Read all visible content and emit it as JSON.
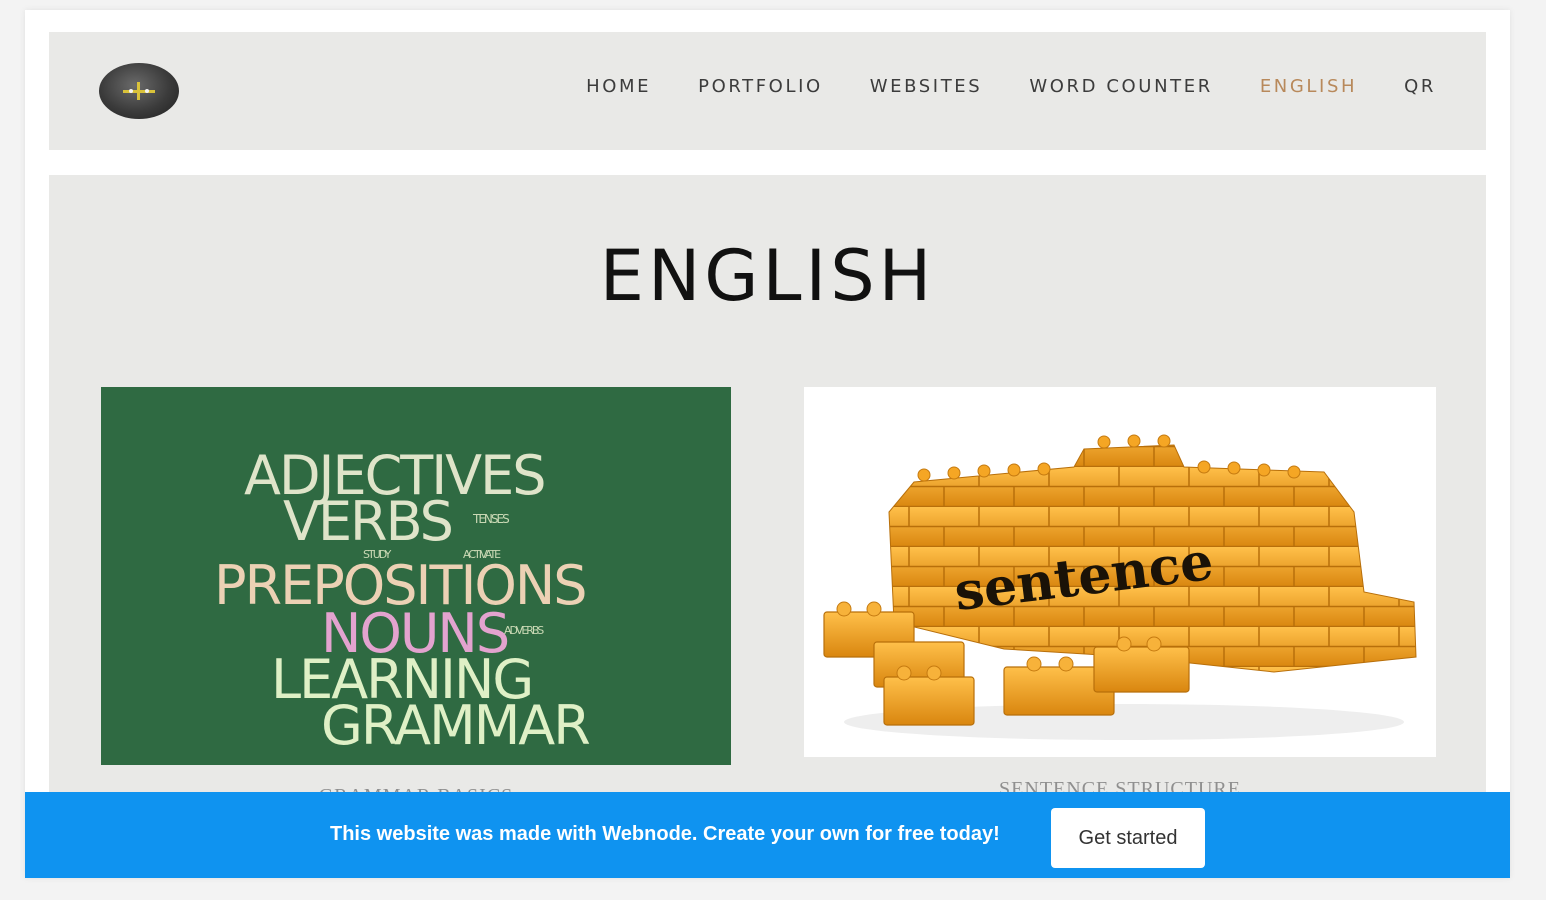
{
  "header": {
    "logo_name": "logo-icon",
    "nav": [
      {
        "label": "HOME"
      },
      {
        "label": "PORTFOLIO"
      },
      {
        "label": "WEBSITES"
      },
      {
        "label": "WORD COUNTER"
      },
      {
        "label": "ENGLISH",
        "active": true
      },
      {
        "label": "QR"
      }
    ]
  },
  "main": {
    "title": "ENGLISH",
    "cards": [
      {
        "caption": "GRAMMAR BASICS",
        "image": {
          "background": "#2f6a42",
          "words": [
            "ADJECTIVES",
            "VERBS",
            "TENSES",
            "STUDY",
            "ACTIVATE",
            "PREPOSITIONS",
            "NOUNS",
            "ADVERBS",
            "LEARNING",
            "GRAMMAR"
          ]
        }
      },
      {
        "caption": "SENTENCE STRUCTURE",
        "image": {
          "word": "sentence",
          "brick_color": "#f2a623"
        }
      }
    ]
  },
  "banner": {
    "text": "This website was made with Webnode. Create your own for free today!",
    "button_label": "Get started",
    "color": "#0f93f0"
  },
  "colors": {
    "accent": "#b8895b",
    "panel": "#e9e9e7"
  }
}
